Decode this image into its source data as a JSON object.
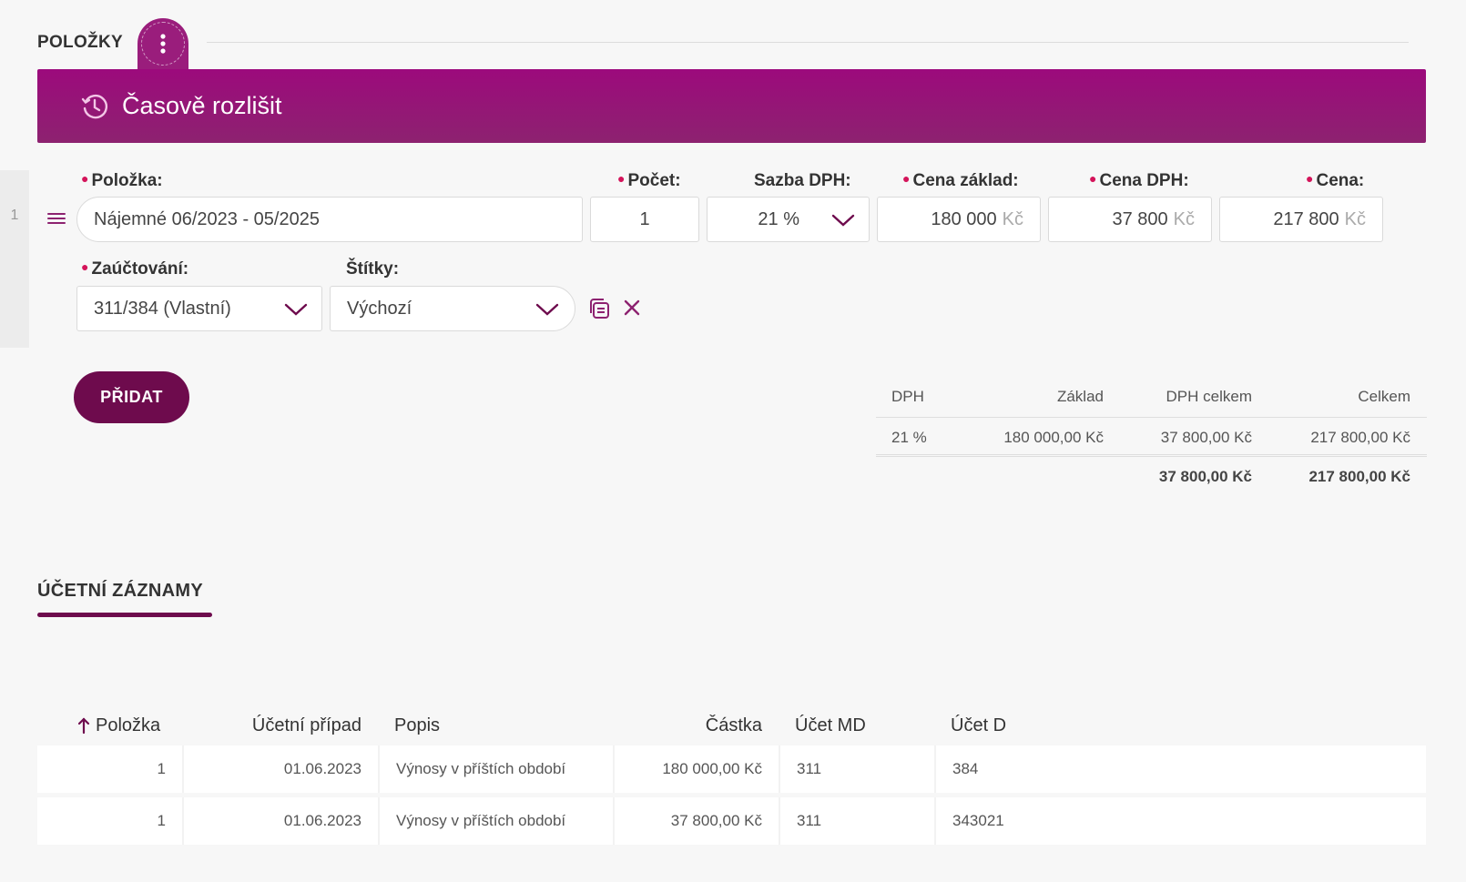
{
  "section": {
    "title": "POLOŽKY"
  },
  "banner": {
    "label": "Časově rozlišit",
    "icon": "clock-history-icon"
  },
  "item": {
    "row_number": "1",
    "labels": {
      "polozka": "Položka:",
      "pocet": "Počet:",
      "sazba": "Sazba DPH:",
      "cena_zaklad": "Cena základ:",
      "cena_dph": "Cena DPH:",
      "cena": "Cena:",
      "zauctovani": "Zaúčtování:",
      "stitky": "Štítky:"
    },
    "values": {
      "polozka": "Nájemné 06/2023 - 05/2025",
      "pocet": "1",
      "sazba": "21 %",
      "cena_zaklad": "180 000",
      "cena_dph": "37 800",
      "cena": "217 800",
      "currency": "Kč",
      "zauctovani": "311/384 (Vlastní)",
      "stitky": "Výchozí"
    }
  },
  "add_button": {
    "label": "PŘIDAT"
  },
  "summary": {
    "headers": {
      "dph": "DPH",
      "zaklad": "Základ",
      "dph_celkem": "DPH celkem",
      "celkem": "Celkem"
    },
    "rows": [
      {
        "dph": "21 %",
        "zaklad": "180 000,00 Kč",
        "dph_celkem": "37 800,00 Kč",
        "celkem": "217 800,00 Kč"
      }
    ],
    "total": {
      "dph_celkem": "37 800,00 Kč",
      "celkem": "217 800,00 Kč"
    }
  },
  "tabs": {
    "ucetni_zaznamy": "ÚČETNÍ ZÁZNAMY"
  },
  "entries": {
    "headers": {
      "polozka": "Položka",
      "ucetni_pripad": "Účetní případ",
      "popis": "Popis",
      "castka": "Částka",
      "ucet_md": "Účet MD",
      "ucet_d": "Účet D"
    },
    "rows": [
      {
        "polozka": "1",
        "ucetni_pripad": "01.06.2023",
        "popis": "Výnosy v příštích období",
        "castka": "180 000,00 Kč",
        "ucet_md": "311",
        "ucet_d": "384"
      },
      {
        "polozka": "1",
        "ucetni_pripad": "01.06.2023",
        "popis": "Výnosy v příštích období",
        "castka": "37 800,00 Kč",
        "ucet_md": "311",
        "ucet_d": "343021"
      }
    ]
  },
  "colors": {
    "accent": "#9a1d7c",
    "accent_dark": "#6e0b4d",
    "required": "#d4145a"
  }
}
